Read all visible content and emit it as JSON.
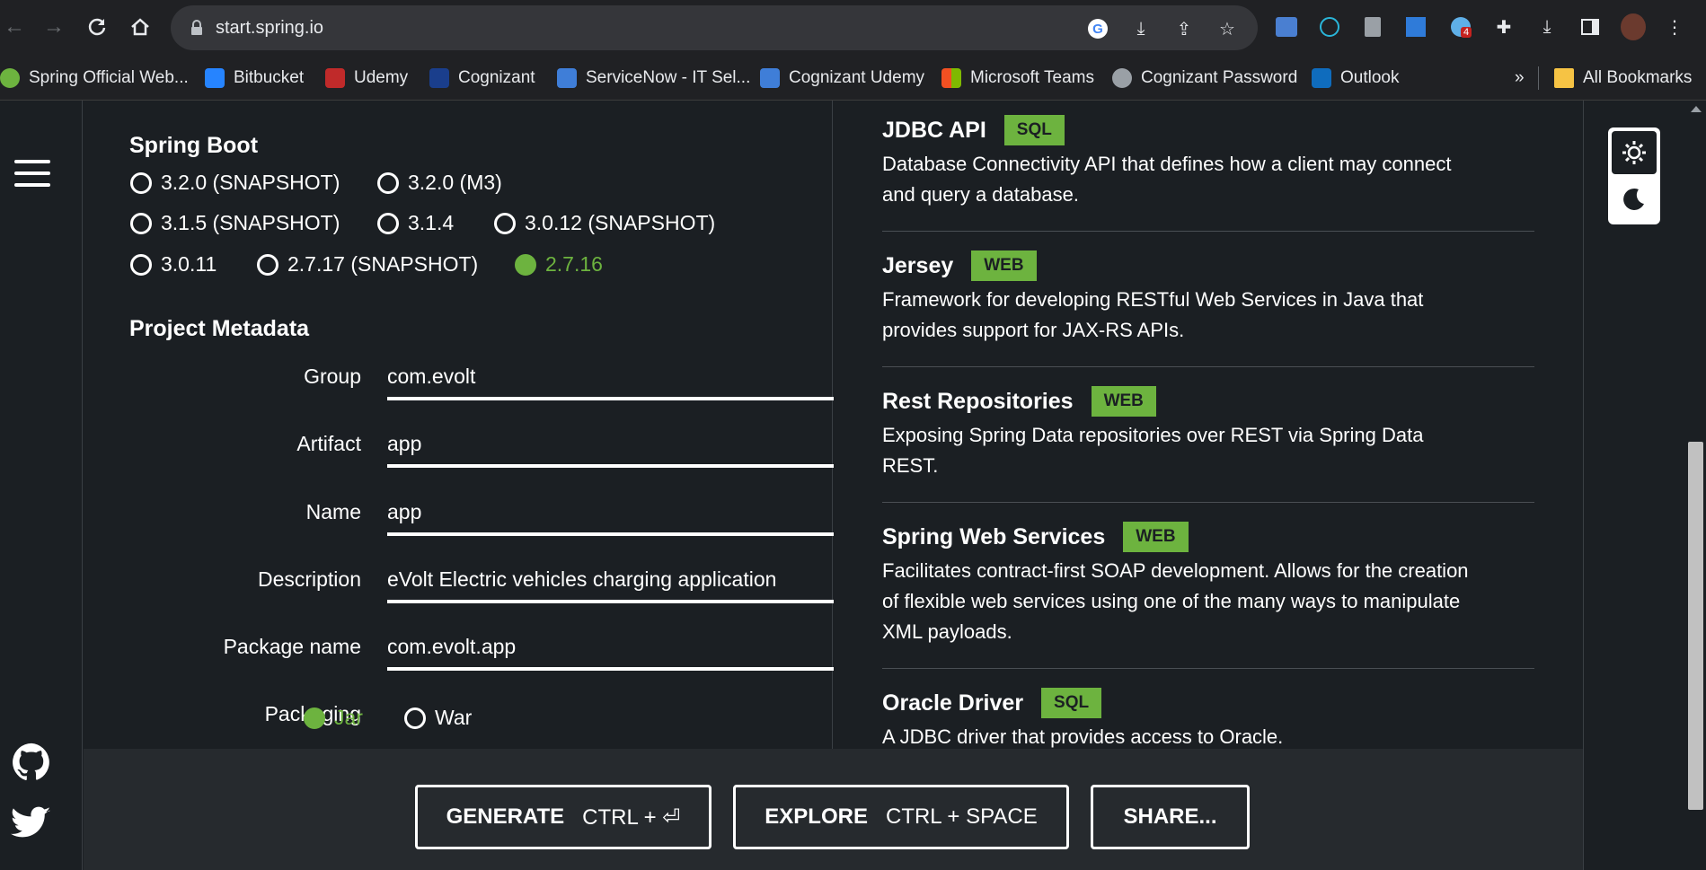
{
  "browser": {
    "url": "start.spring.io",
    "bookmarks": [
      {
        "label": "Spring Official Web...",
        "color": "#6db33f"
      },
      {
        "label": "Bitbucket",
        "color": "#2684ff"
      },
      {
        "label": "Udemy",
        "color": "#a435f0"
      },
      {
        "label": "Cognizant",
        "color": "#1a3e8c"
      },
      {
        "label": "ServiceNow - IT Sel...",
        "color": "#3f7ed8"
      },
      {
        "label": "Cognizant Udemy",
        "color": "#3f7ed8"
      },
      {
        "label": "Microsoft Teams",
        "color": "#f25022"
      },
      {
        "label": "Cognizant Password",
        "color": "#9aa0a6"
      },
      {
        "label": "Outlook",
        "color": "#0f6cbd"
      }
    ],
    "more_label": "»",
    "all_bookmarks": "All Bookmarks",
    "ext_badge": "4"
  },
  "spring_boot": {
    "title": "Spring Boot",
    "options": [
      "3.2.0 (SNAPSHOT)",
      "3.2.0 (M3)",
      "3.1.5 (SNAPSHOT)",
      "3.1.4",
      "3.0.12 (SNAPSHOT)",
      "3.0.11",
      "2.7.17 (SNAPSHOT)",
      "2.7.16"
    ],
    "selected": "2.7.16"
  },
  "metadata": {
    "title": "Project Metadata",
    "group_label": "Group",
    "group": "com.evolt",
    "artifact_label": "Artifact",
    "artifact": "app",
    "name_label": "Name",
    "name": "app",
    "description_label": "Description",
    "description": "eVolt Electric vehicles charging application",
    "package_label": "Package name",
    "package": "com.evolt.app",
    "packaging_label": "Packaging",
    "packaging_options": [
      "Jar",
      "War"
    ],
    "packaging_selected": "Jar"
  },
  "dependencies": [
    {
      "name": "JDBC API",
      "tag": "SQL",
      "desc": "Database Connectivity API that defines how a client may connect and query a database."
    },
    {
      "name": "Jersey",
      "tag": "WEB",
      "desc": "Framework for developing RESTful Web Services in Java that provides support for JAX-RS APIs."
    },
    {
      "name": "Rest Repositories",
      "tag": "WEB",
      "desc": "Exposing Spring Data repositories over REST via Spring Data REST."
    },
    {
      "name": "Spring Web Services",
      "tag": "WEB",
      "desc": "Facilitates contract-first SOAP development. Allows for the creation of flexible web services using one of the many ways to manipulate XML payloads."
    },
    {
      "name": "Oracle Driver",
      "tag": "SQL",
      "desc": "A JDBC driver that provides access to Oracle."
    }
  ],
  "footer": {
    "generate": "GENERATE",
    "generate_shortcut": "CTRL + ⏎",
    "explore": "EXPLORE",
    "explore_shortcut": "CTRL + SPACE",
    "share": "SHARE..."
  }
}
